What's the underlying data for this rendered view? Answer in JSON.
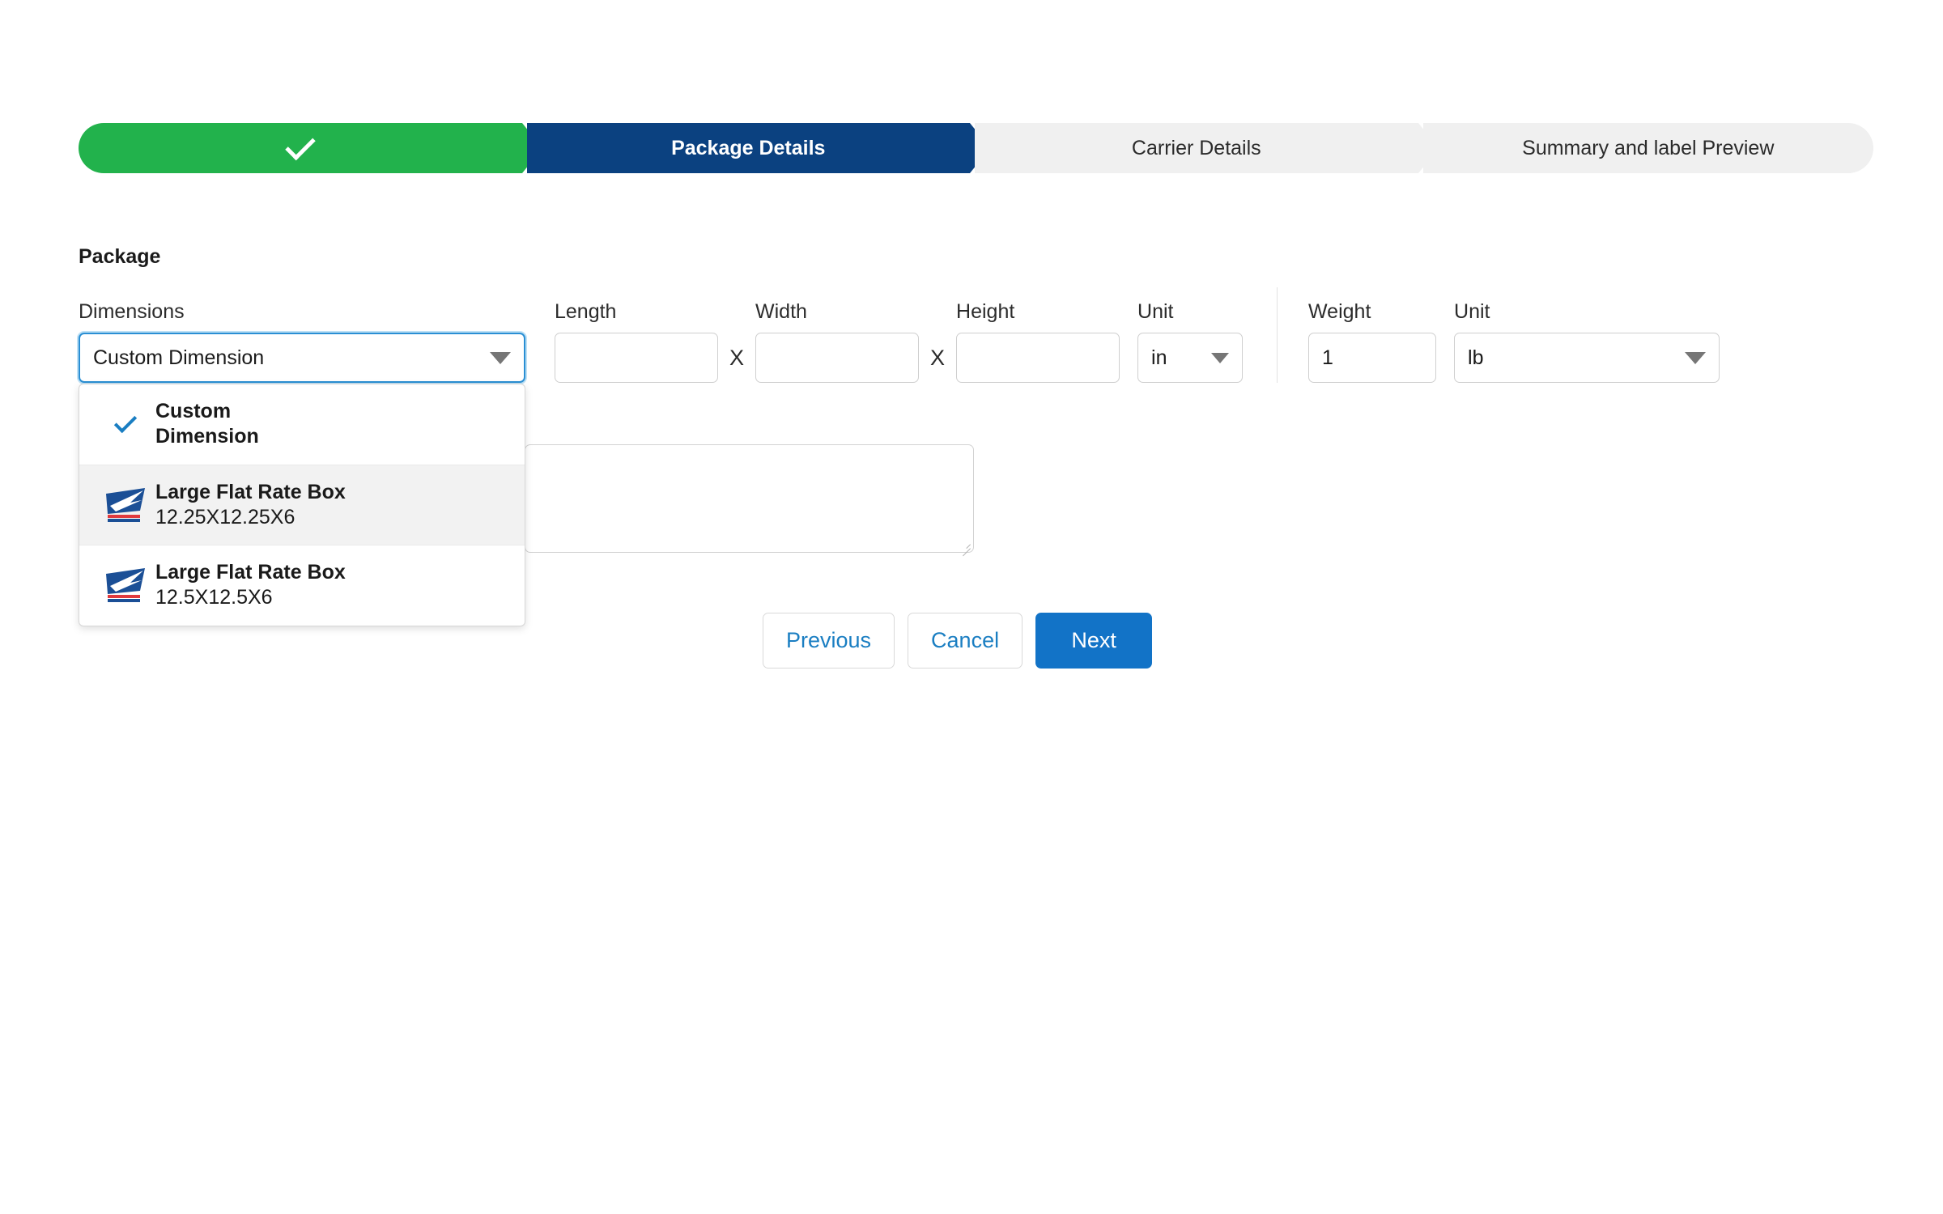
{
  "stepper": {
    "steps": [
      {
        "label": "",
        "state": "completed",
        "icon": "check-icon"
      },
      {
        "label": "Package Details",
        "state": "active"
      },
      {
        "label": "Carrier Details",
        "state": "upcoming"
      },
      {
        "label": "Summary and label Preview",
        "state": "upcoming"
      }
    ],
    "colors": {
      "completed": "#22b24c",
      "active": "#0b4180",
      "upcoming": "#f0f0f0"
    }
  },
  "package": {
    "section_title": "Package",
    "dimensions": {
      "label": "Dimensions",
      "selected": "Custom Dimension",
      "options": [
        {
          "title": "Custom Dimension",
          "subtitle": "",
          "selected": true,
          "logo": ""
        },
        {
          "title": "Large Flat Rate Box",
          "subtitle": "12.25X12.25X6",
          "selected": false,
          "logo": "usps-logo"
        },
        {
          "title": "Large Flat Rate Box",
          "subtitle": "12.5X12.5X6",
          "selected": false,
          "logo": "usps-logo"
        }
      ]
    },
    "length": {
      "label": "Length",
      "value": "",
      "placeholder": ""
    },
    "width": {
      "label": "Width",
      "value": "",
      "placeholder": ""
    },
    "height": {
      "label": "Height",
      "value": "",
      "placeholder": ""
    },
    "dim_unit": {
      "label": "Unit",
      "value": "in"
    },
    "weight": {
      "label": "Weight",
      "value": "1",
      "placeholder": ""
    },
    "weight_unit": {
      "label": "Unit",
      "value": "lb"
    },
    "separator_x": "X",
    "notes": {
      "value": "",
      "placeholder": ""
    }
  },
  "actions": {
    "previous_label": "Previous",
    "cancel_label": "Cancel",
    "next_label": "Next",
    "primary_color": "#1273c7",
    "link_color": "#1a7ec2"
  }
}
